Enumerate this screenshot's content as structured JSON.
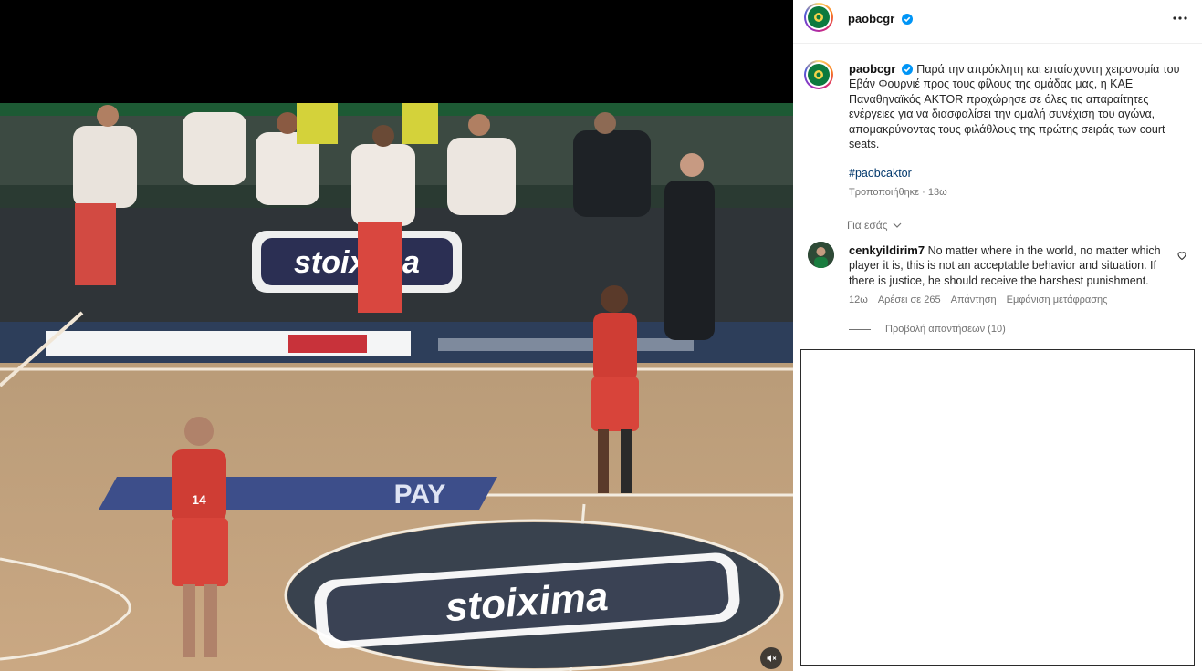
{
  "post": {
    "username": "paobcgr",
    "caption": "Παρά την απρόκλητη και επαίσχυντη χειρονομία του Εβάν Φουρνιέ προς τους φίλους της ομάδας μας, η ΚΑΕ Παναθηναϊκός AKTOR προχώρησε σε όλες τις απαραίτητες ενέργειες για να διασφαλίσει την ομαλή συνέχιση του αγώνα, απομακρύνοντας τους φιλάθλους της πρώτης σειράς των court seats.",
    "hashtag": "#paobcaktor",
    "edited_label": "Τροποποιήθηκε",
    "time": "13ω",
    "for_you_label": "Για εσάς"
  },
  "comment": {
    "username": "cenkyildirim7",
    "text": "No matter where in the world, no matter which player it is, this is not an acceptable behavior and situation. If there is justice, he should receive the harshest punishment.",
    "time": "12ω",
    "likes": "Αρέσει σε 265",
    "reply_label": "Απάντηση",
    "translate_label": "Εμφάνιση μετάφρασης",
    "view_replies": "Προβολή απαντήσεων (10)"
  },
  "video": {
    "banner_top": "stoixima",
    "center_logo": "stoixima",
    "floor_ad": "PAY",
    "jersey_number": "14",
    "muted": true
  },
  "colors": {
    "link": "#00376b",
    "secondary_text": "#737373",
    "verified": "#0095f6",
    "team_green": "#0c7a3e"
  },
  "icons": [
    "verified-badge-icon",
    "more-options-icon",
    "chevron-down-icon",
    "heart-icon",
    "speaker-muted-icon"
  ]
}
